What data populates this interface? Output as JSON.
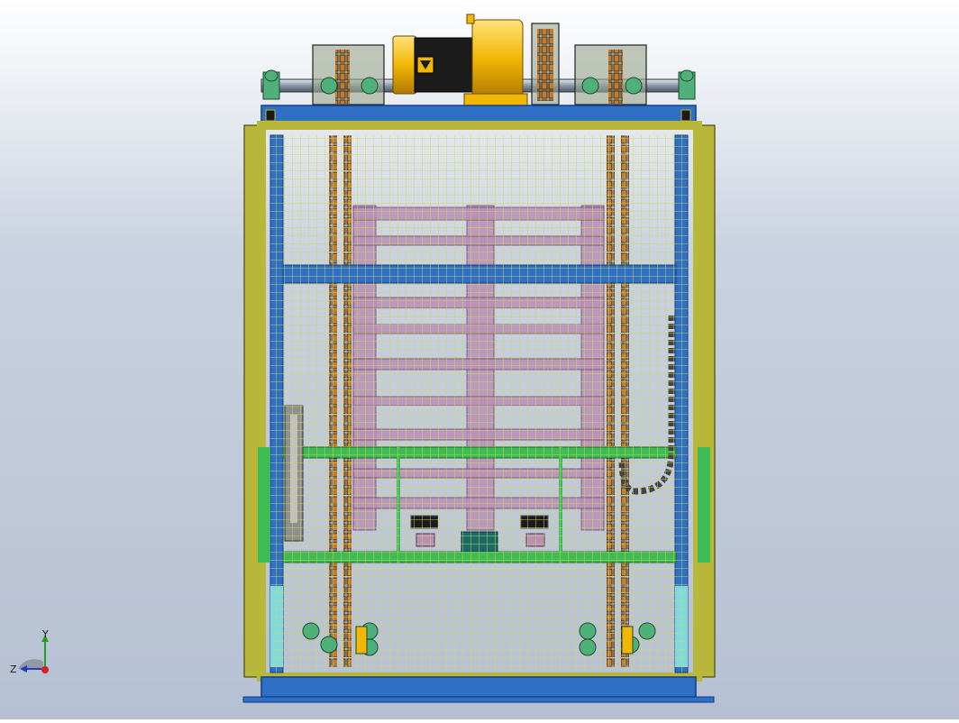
{
  "viewport": {
    "background_top": "#ffffff",
    "background_bottom": "#b5c0d2"
  },
  "colors": {
    "frame_olive": "#b9b73a",
    "frame_olive_dark": "#6f6e1c",
    "beam_blue": "#2f6fc4",
    "beam_blue_dark": "#123f86",
    "mesh_yellow": "#d6d84a",
    "pallet_pink": "#b98fb8",
    "carriage_green": "#3dbb55",
    "motor_gold": "#f2b705",
    "motor_black": "#1b1b1b",
    "roller_teal": "#4fb07a",
    "chain_brown": "#8a5a2b",
    "cyan_panel": "#7fd9e0"
  },
  "triad": {
    "y_label": "Y",
    "z_label": "Z",
    "x_color": "#d62020",
    "y_color": "#20a020",
    "z_color": "#2040c0"
  },
  "icons": {
    "triad": "coordinate-triad-icon",
    "motor": "gear-motor-icon",
    "sprocket": "sprocket-icon"
  }
}
